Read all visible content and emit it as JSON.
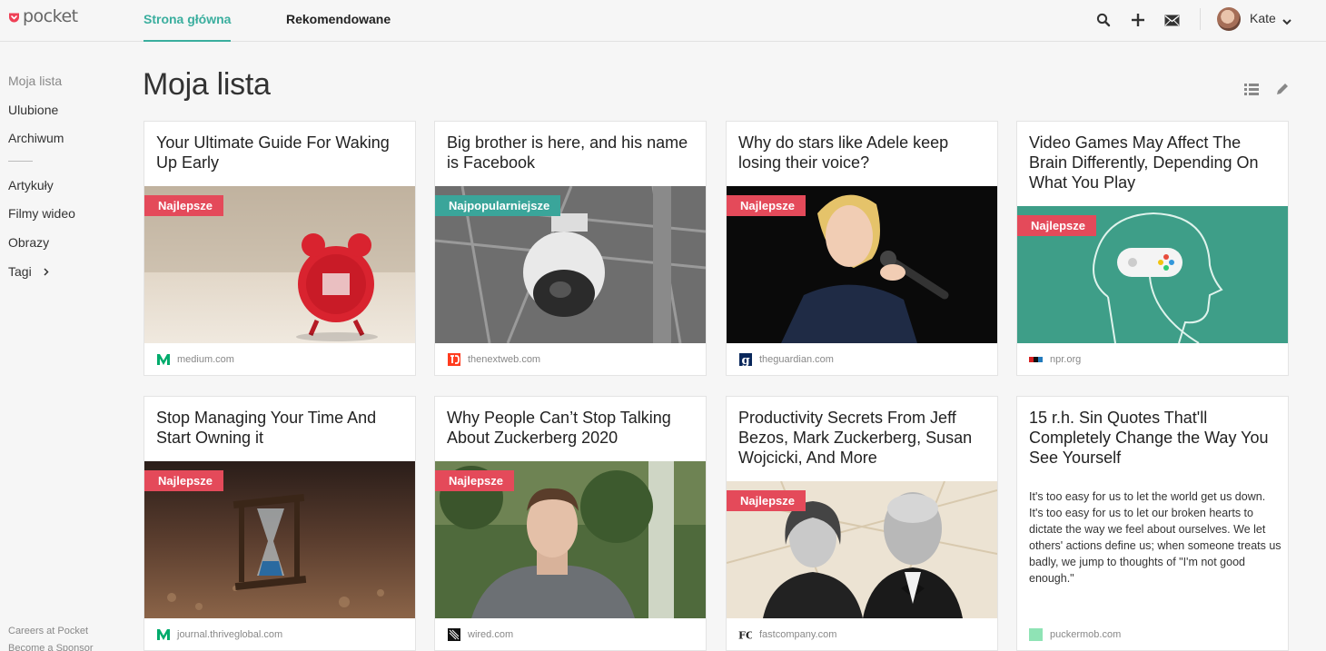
{
  "header": {
    "logo_text": "pocket",
    "tabs": [
      {
        "label": "Strona główna",
        "active": true
      },
      {
        "label": "Rekomendowane",
        "active": false
      }
    ],
    "icons": [
      "search-icon",
      "add-icon",
      "mail-icon"
    ],
    "user": {
      "name": "Kate"
    }
  },
  "sidebar": {
    "items": [
      {
        "label": "Moja lista",
        "selected": true
      },
      {
        "label": "Ulubione"
      },
      {
        "label": "Archiwum"
      },
      {
        "label": "Artykuły"
      },
      {
        "label": "Filmy wideo"
      },
      {
        "label": "Obrazy"
      },
      {
        "label": "Tagi"
      }
    ],
    "footer": [
      "Careers at Pocket",
      "Become a Sponsor"
    ]
  },
  "main": {
    "title": "Moja lista",
    "tools": [
      "list-view-icon",
      "edit-icon"
    ]
  },
  "colors": {
    "accent": "#3aae9e",
    "badge_best": "#e44a5a",
    "badge_popular": "#3aa59a",
    "pocket_red": "#ef4056"
  },
  "cards": [
    {
      "title": "Your Ultimate Guide For Waking Up Early",
      "badge": "Najlepsze",
      "source": "medium.com",
      "image": "alarm-clock"
    },
    {
      "title": "Big brother is here, and his name is Facebook",
      "badge": "Najpopularniejsze",
      "source": "thenextweb.com",
      "image": "security-camera"
    },
    {
      "title": "Why do stars like Adele keep losing their voice?",
      "badge": "Najlepsze",
      "source": "theguardian.com",
      "image": "singer"
    },
    {
      "title": "Video Games May Affect The Brain Differently, Depending On What You Play",
      "badge": "Najlepsze",
      "source": "npr.org",
      "image": "gamepad-head"
    },
    {
      "title": "Stop Managing Your Time And Start Owning it",
      "badge": "Najlepsze",
      "source": "journal.thriveglobal.com",
      "image": "hourglass"
    },
    {
      "title": "Why People Can’t Stop Talking About Zuckerberg 2020",
      "badge": "Najlepsze",
      "source": "wired.com",
      "image": "man-portrait"
    },
    {
      "title": "Productivity Secrets From Jeff Bezos, Mark Zuckerberg, Susan Wojcicki, And More",
      "badge": "Najlepsze",
      "source": "fastcompany.com",
      "image": "two-executives"
    },
    {
      "title": "15 r.h. Sin Quotes That'll Completely Change the Way You See Yourself",
      "badge": "",
      "source": "puckermob.com",
      "excerpt": "It's too easy for us to let the world get us down. It's too easy for us to let our broken hearts to dictate the way we feel about ourselves. We let others' actions define us; when someone treats us badly, we jump to thoughts of \"I'm not good enough.\""
    }
  ]
}
